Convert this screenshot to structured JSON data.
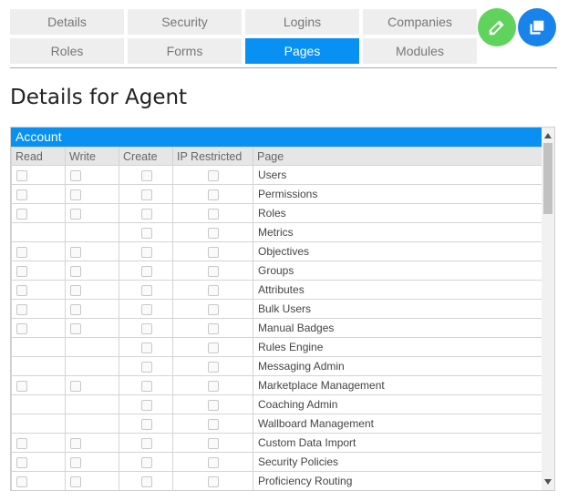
{
  "tabs": [
    {
      "label": "Details",
      "active": false
    },
    {
      "label": "Security",
      "active": false
    },
    {
      "label": "Logins",
      "active": false
    },
    {
      "label": "Companies",
      "active": false
    },
    {
      "label": "Roles",
      "active": false
    },
    {
      "label": "Forms",
      "active": false
    },
    {
      "label": "Pages",
      "active": true
    },
    {
      "label": "Modules",
      "active": false
    }
  ],
  "actions": {
    "edit_icon": "pencil-icon",
    "copy_icon": "copy-icon",
    "edit_color": "#5fd35c",
    "copy_color": "#1883ea"
  },
  "title": "Details for Agent",
  "grid": {
    "group_label": "Account",
    "columns": [
      "Read",
      "Write",
      "Create",
      "IP Restricted",
      "Page"
    ],
    "rows": [
      {
        "page": "Users",
        "read": true,
        "write": true
      },
      {
        "page": "Permissions",
        "read": true,
        "write": true
      },
      {
        "page": "Roles",
        "read": true,
        "write": true
      },
      {
        "page": "Metrics",
        "read": false,
        "write": false
      },
      {
        "page": "Objectives",
        "read": true,
        "write": true
      },
      {
        "page": "Groups",
        "read": true,
        "write": true
      },
      {
        "page": "Attributes",
        "read": true,
        "write": true
      },
      {
        "page": "Bulk Users",
        "read": true,
        "write": true
      },
      {
        "page": "Manual Badges",
        "read": true,
        "write": true
      },
      {
        "page": "Rules Engine",
        "read": false,
        "write": false
      },
      {
        "page": "Messaging Admin",
        "read": false,
        "write": false
      },
      {
        "page": "Marketplace Management",
        "read": true,
        "write": true
      },
      {
        "page": "Coaching Admin",
        "read": false,
        "write": false
      },
      {
        "page": "Wallboard Management",
        "read": false,
        "write": false
      },
      {
        "page": "Custom Data Import",
        "read": true,
        "write": true
      },
      {
        "page": "Security Policies",
        "read": true,
        "write": true
      },
      {
        "page": "Proficiency Routing",
        "read": true,
        "write": true
      }
    ]
  },
  "colors": {
    "accent": "#0891f2",
    "tab_bg": "#eeeeee"
  }
}
